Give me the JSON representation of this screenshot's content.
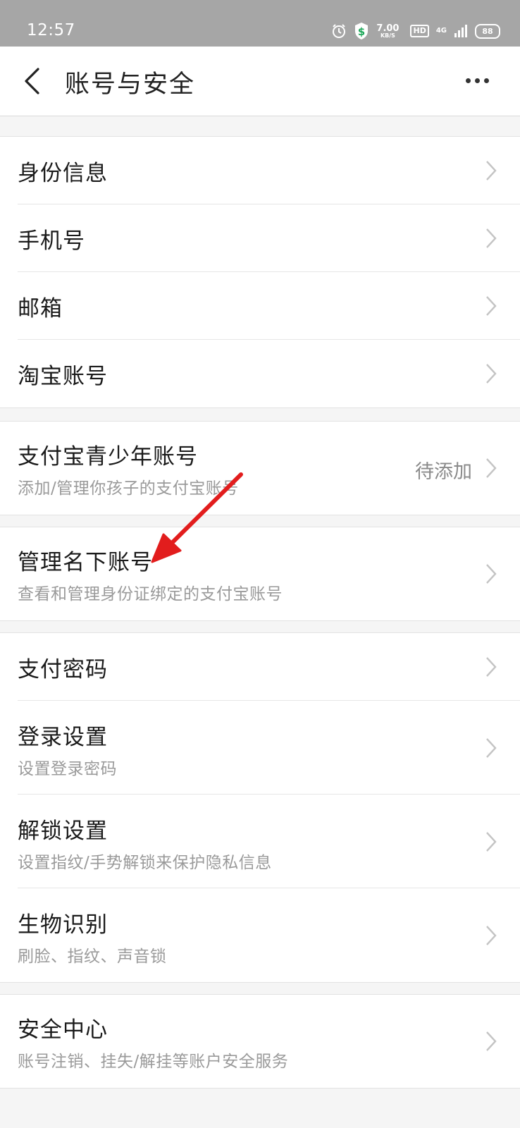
{
  "status_bar": {
    "time": "12:57",
    "speed_value": "7.00",
    "speed_unit": "KB/S",
    "hd_label": "HD",
    "network_label": "4G",
    "battery": "88"
  },
  "header": {
    "title": "账号与安全"
  },
  "groups": [
    {
      "items": [
        {
          "title": "身份信息"
        },
        {
          "title": "手机号"
        },
        {
          "title": "邮箱"
        },
        {
          "title": "淘宝账号"
        }
      ]
    },
    {
      "items": [
        {
          "title": "支付宝青少年账号",
          "subtitle": "添加/管理你孩子的支付宝账号",
          "value": "待添加"
        }
      ]
    },
    {
      "items": [
        {
          "title": "管理名下账号",
          "subtitle": "查看和管理身份证绑定的支付宝账号"
        }
      ]
    },
    {
      "items": [
        {
          "title": "支付密码"
        },
        {
          "title": "登录设置",
          "subtitle": "设置登录密码"
        },
        {
          "title": "解锁设置",
          "subtitle": "设置指纹/手势解锁来保护隐私信息"
        },
        {
          "title": "生物识别",
          "subtitle": "刷脸、指纹、声音锁"
        }
      ]
    },
    {
      "items": [
        {
          "title": "安全中心",
          "subtitle": "账号注销、挂失/解挂等账户安全服务"
        }
      ]
    }
  ],
  "colors": {
    "annotation_arrow": "#e21d1d",
    "status_bar_bg": "#a6a6a6"
  }
}
